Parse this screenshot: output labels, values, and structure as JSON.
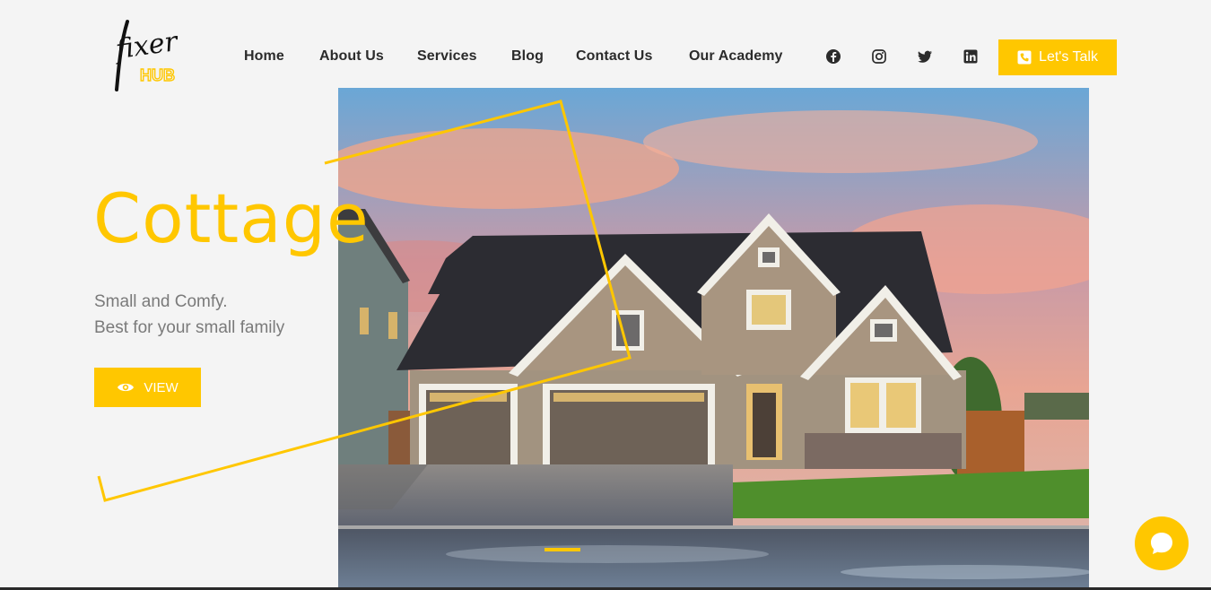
{
  "brand": {
    "logo_text_top": "fixer",
    "logo_text_bottom": "HUB"
  },
  "nav": {
    "items": [
      {
        "label": "Home"
      },
      {
        "label": "About Us"
      },
      {
        "label": "Services"
      },
      {
        "label": "Blog"
      },
      {
        "label": "Contact Us"
      },
      {
        "label": "Our Academy"
      }
    ]
  },
  "social": [
    "facebook-icon",
    "instagram-icon",
    "twitter-icon",
    "linkedin-icon"
  ],
  "cta": {
    "label": "Let's Talk",
    "icon": "phone-icon"
  },
  "hero": {
    "title": "Cottage",
    "subtitle_line1": "Small and Comfy.",
    "subtitle_line2": "Best for your small family",
    "button_label": "VIEW",
    "button_icon": "eye-icon"
  },
  "colors": {
    "accent": "#ffc700",
    "background": "#f4f4f4",
    "nav_text": "#2b2b2b",
    "muted_text": "#7a7a7a"
  }
}
